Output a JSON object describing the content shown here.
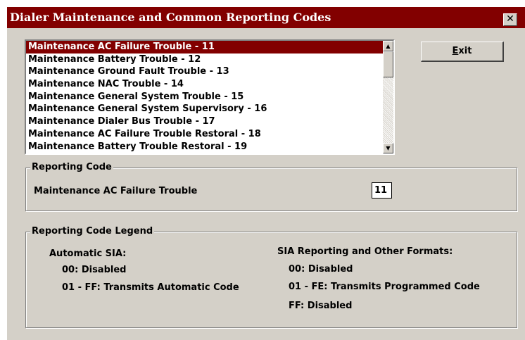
{
  "window": {
    "title": "Dialer Maintenance and Common Reporting Codes",
    "close_label": "✕",
    "title_bar_color": "#820000",
    "face_color": "#d4d0c8"
  },
  "list": {
    "items": [
      {
        "label": "Maintenance AC Failure Trouble - 11",
        "selected": true
      },
      {
        "label": "Maintenance Battery Trouble - 12"
      },
      {
        "label": "Maintenance Ground Fault Trouble - 13"
      },
      {
        "label": "Maintenance NAC Trouble - 14"
      },
      {
        "label": "Maintenance General System Trouble - 15"
      },
      {
        "label": "Maintenance General System Supervisory - 16"
      },
      {
        "label": "Maintenance Dialer Bus Trouble - 17"
      },
      {
        "label": "Maintenance AC Failure Trouble Restoral - 18"
      },
      {
        "label": "Maintenance Battery Trouble Restoral - 19"
      }
    ],
    "scroll_up_icon": "▲",
    "scroll_down_icon": "▼"
  },
  "exit_button": {
    "label": "Exit"
  },
  "reporting_code": {
    "legend": "Reporting Code",
    "name": "Maintenance AC Failure Trouble",
    "value": "11"
  },
  "legend_group": {
    "legend": "Reporting Code Legend",
    "automatic": {
      "heading": "Automatic SIA:",
      "line1": "00: Disabled",
      "line2": "01 - FF: Transmits Automatic Code"
    },
    "sia": {
      "heading": "SIA Reporting and Other Formats:",
      "line1": "00: Disabled",
      "line2": "01 - FE: Transmits Programmed Code",
      "line3": "FF: Disabled"
    }
  }
}
